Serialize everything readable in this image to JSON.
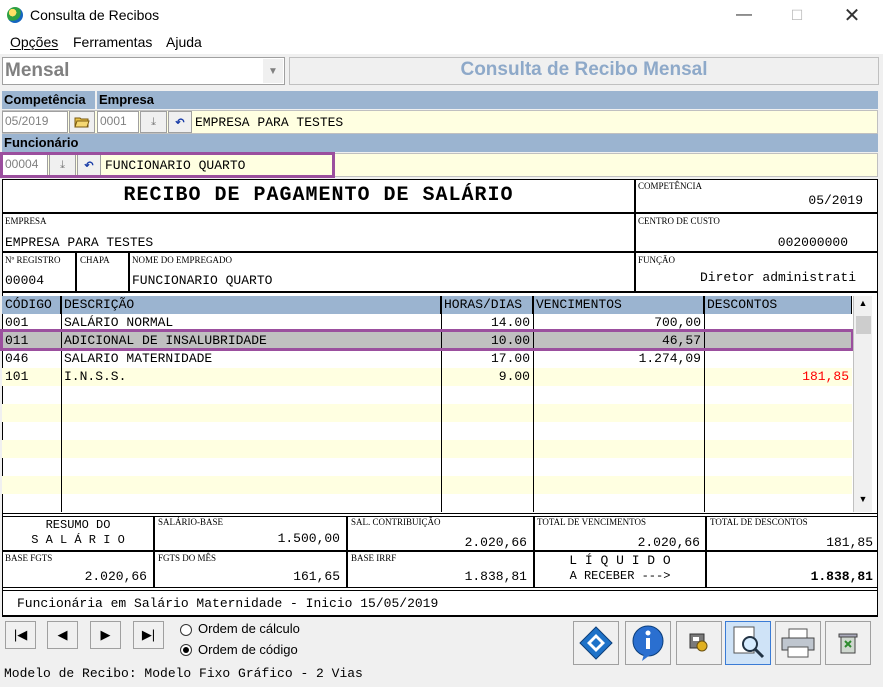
{
  "window": {
    "title": "Consulta de Recibos"
  },
  "menu": {
    "items": [
      {
        "label": "Opções",
        "underline": "O"
      },
      {
        "label": "Ferramentas",
        "underline": "F"
      },
      {
        "label": "Ajuda",
        "underline": "j"
      }
    ]
  },
  "mode": {
    "selected": "Mensal",
    "header_title": "Consulta de Recibo Mensal"
  },
  "filters": {
    "competencia_label": "Competência",
    "empresa_label": "Empresa",
    "funcionario_label": "Funcionário",
    "competencia_value": "05/2019",
    "empresa_code": "0001",
    "empresa_name": "EMPRESA PARA TESTES",
    "funcionario_code": "00004",
    "funcionario_name": "FUNCIONARIO QUARTO"
  },
  "receipt": {
    "title": "RECIBO DE PAGAMENTO DE SALÁRIO",
    "competencia_label": "COMPETÊNCIA",
    "competencia_value": "05/2019",
    "empresa_label": "EMPRESA",
    "empresa_value": "EMPRESA PARA TESTES",
    "centro_custo_label": "CENTRO DE CUSTO",
    "centro_custo_value": "002000000",
    "registro_label": "Nº REGISTRO",
    "registro_value": "00004",
    "chapa_label": "CHAPA",
    "chapa_value": "",
    "nome_label": "NOME DO EMPREGADO",
    "nome_value": "FUNCIONARIO QUARTO",
    "funcao_label": "FUNÇÃO",
    "funcao_value": "Diretor administrati"
  },
  "table": {
    "headers": [
      "CÓDIGO",
      "DESCRIÇÃO",
      "HORAS/DIAS",
      "VENCIMENTOS",
      "DESCONTOS"
    ],
    "rows": [
      {
        "codigo": "001",
        "descricao": "SALÁRIO NORMAL",
        "horas": "14.00",
        "vencimentos": "700,00",
        "descontos": ""
      },
      {
        "codigo": "011",
        "descricao": "ADICIONAL DE INSALUBRIDADE",
        "horas": "10.00",
        "vencimentos": "46,57",
        "descontos": ""
      },
      {
        "codigo": "046",
        "descricao": "SALARIO MATERNIDADE",
        "horas": "17.00",
        "vencimentos": "1.274,09",
        "descontos": ""
      },
      {
        "codigo": "101",
        "descricao": "I.N.S.S.",
        "horas": "9.00",
        "vencimentos": "",
        "descontos": "181,85"
      }
    ]
  },
  "summary": {
    "resumo_line1": "RESUMO DO",
    "resumo_line2": "S A L Á R I O",
    "salario_base_label": "SALÁRIO-BASE",
    "salario_base_value": "1.500,00",
    "sal_contribuicao_label": "SAL. CONTRIBUIÇÃO",
    "sal_contribuicao_value": "2.020,66",
    "total_vencimentos_label": "TOTAL DE VENCIMENTOS",
    "total_vencimentos_value": "2.020,66",
    "total_descontos_label": "TOTAL DE DESCONTOS",
    "total_descontos_value": "181,85",
    "base_fgts_label": "BASE FGTS",
    "base_fgts_value": "2.020,66",
    "fgts_mes_label": "FGTS DO MÊS",
    "fgts_mes_value": "161,65",
    "base_irrf_label": "BASE IRRF",
    "base_irrf_value": "1.838,81",
    "liquido_line1": "L Í Q U I D O",
    "liquido_line2": "A RECEBER --->",
    "liquido_value": "1.838,81"
  },
  "observation": "Funcionária em Salário Maternidade - Inicio 15/05/2019",
  "order": {
    "calc_label": "Ordem de cálculo",
    "code_label": "Ordem de código",
    "selected": "code"
  },
  "footer": {
    "model_text": "Modelo de Recibo: Modelo Fixo Gráfico - 2 Vias"
  },
  "colors": {
    "band": "#9bb4d0",
    "highlight": "#9b4f9e",
    "discount": "#ff0000",
    "row_yellow": "#ffffe1",
    "selected_row": "#c0c0c0"
  }
}
